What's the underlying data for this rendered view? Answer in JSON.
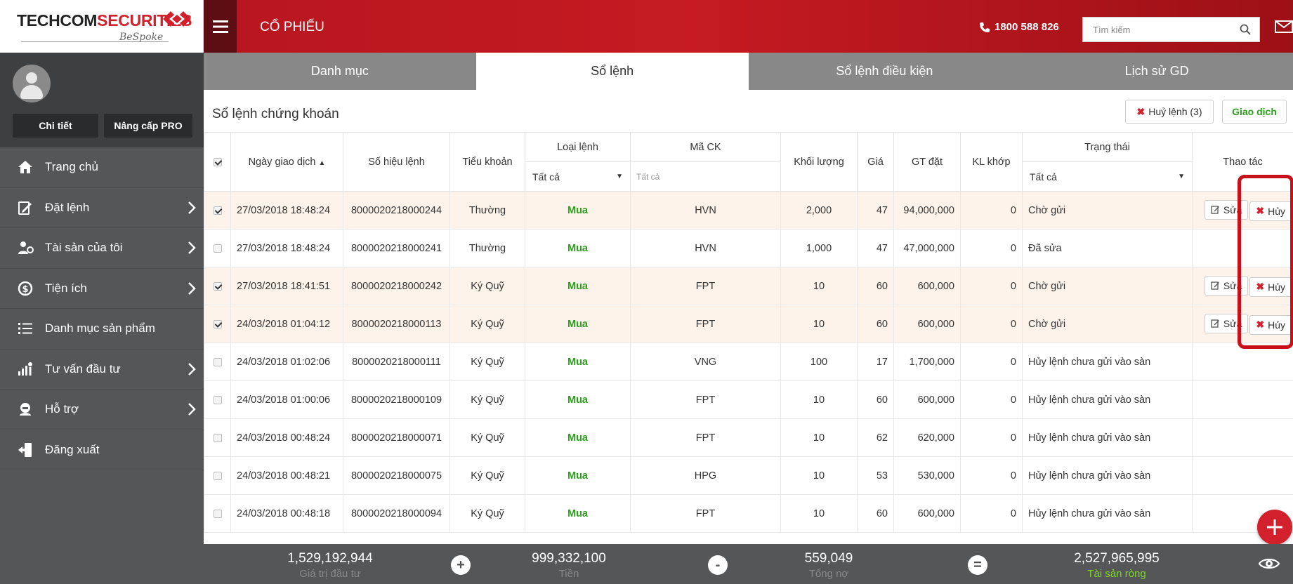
{
  "brand": {
    "name_black": "TECHCOM",
    "name_red": "SECURITIES",
    "sub": "BeSpoke"
  },
  "user": {
    "detail_label": "Chi tiết",
    "upgrade_label": "Nâng cấp PRO"
  },
  "menu": [
    {
      "label": "Trang chủ",
      "icon": "home-icon",
      "chevron": false
    },
    {
      "label": "Đặt lệnh",
      "icon": "order-icon",
      "chevron": true
    },
    {
      "label": "Tài sản của tôi",
      "icon": "assets-icon",
      "chevron": true
    },
    {
      "label": "Tiện ích",
      "icon": "utilities-icon",
      "chevron": true
    },
    {
      "label": "Danh mục sản phẩm",
      "icon": "list-icon",
      "chevron": false
    },
    {
      "label": "Tư vấn đầu tư",
      "icon": "advisory-icon",
      "chevron": true
    },
    {
      "label": "Hỗ trợ",
      "icon": "support-icon",
      "chevron": true
    },
    {
      "label": "Đăng xuất",
      "icon": "logout-icon",
      "chevron": false
    }
  ],
  "topbar": {
    "title": "CỔ PHIẾU",
    "phone": "1800 588 826",
    "search_placeholder": "Tìm kiếm"
  },
  "tabs": [
    {
      "label": "Danh mục",
      "active": false
    },
    {
      "label": "Sổ lệnh",
      "active": true
    },
    {
      "label": "Sổ lệnh điều kiện",
      "active": false
    },
    {
      "label": "Lịch sử GD",
      "active": false
    }
  ],
  "panel": {
    "title": "Sổ lệnh chứng khoán",
    "cancel_all_label": "Huỷ lệnh (3)",
    "trade_label": "Giao dịch"
  },
  "table": {
    "headers": {
      "date": "Ngày giao dịch",
      "order_no": "Số hiệu lệnh",
      "sub_account": "Tiểu khoản",
      "order_type": "Loại lệnh",
      "symbol": "Mã CK",
      "volume": "Khối lượng",
      "price": "Giá",
      "value": "GT đặt",
      "matched": "KL khớp",
      "status": "Trạng thái",
      "actions": "Thao tác"
    },
    "filters": {
      "order_type": "Tất cả",
      "symbol_placeholder": "Tất cả",
      "status": "Tất cả"
    },
    "edit_label": "Sửa",
    "cancel_label": "Hủy",
    "rows": [
      {
        "checked": true,
        "highlight": true,
        "date": "27/03/2018 18:48:24",
        "order_no": "8000020218000244",
        "sub_account": "Thường",
        "side": "Mua",
        "symbol": "HVN",
        "volume": "2,000",
        "price": "47",
        "value": "94,000,000",
        "matched": "0",
        "status": "Chờ gửi",
        "actions": true
      },
      {
        "checked": false,
        "highlight": false,
        "date": "27/03/2018 18:48:24",
        "order_no": "8000020218000241",
        "sub_account": "Thường",
        "side": "Mua",
        "symbol": "HVN",
        "volume": "1,000",
        "price": "47",
        "value": "47,000,000",
        "matched": "0",
        "status": "Đã sửa",
        "actions": false
      },
      {
        "checked": true,
        "highlight": true,
        "date": "27/03/2018 18:41:51",
        "order_no": "8000020218000242",
        "sub_account": "Ký Quỹ",
        "side": "Mua",
        "symbol": "FPT",
        "volume": "10",
        "price": "60",
        "value": "600,000",
        "matched": "0",
        "status": "Chờ gửi",
        "actions": true
      },
      {
        "checked": true,
        "highlight": true,
        "date": "24/03/2018 01:04:12",
        "order_no": "8000020218000113",
        "sub_account": "Ký Quỹ",
        "side": "Mua",
        "symbol": "FPT",
        "volume": "10",
        "price": "60",
        "value": "600,000",
        "matched": "0",
        "status": "Chờ gửi",
        "actions": true
      },
      {
        "checked": false,
        "highlight": false,
        "date": "24/03/2018 01:02:06",
        "order_no": "8000020218000111",
        "sub_account": "Ký Quỹ",
        "side": "Mua",
        "symbol": "VNG",
        "volume": "100",
        "price": "17",
        "value": "1,700,000",
        "matched": "0",
        "status": "Hủy lệnh chưa gửi vào sàn",
        "actions": false
      },
      {
        "checked": false,
        "highlight": false,
        "date": "24/03/2018 01:00:06",
        "order_no": "8000020218000109",
        "sub_account": "Ký Quỹ",
        "side": "Mua",
        "symbol": "FPT",
        "volume": "10",
        "price": "60",
        "value": "600,000",
        "matched": "0",
        "status": "Hủy lệnh chưa gửi vào sàn",
        "actions": false
      },
      {
        "checked": false,
        "highlight": false,
        "date": "24/03/2018 00:48:24",
        "order_no": "8000020218000071",
        "sub_account": "Ký Quỹ",
        "side": "Mua",
        "symbol": "FPT",
        "volume": "10",
        "price": "62",
        "value": "620,000",
        "matched": "0",
        "status": "Hủy lệnh chưa gửi vào sàn",
        "actions": false
      },
      {
        "checked": false,
        "highlight": false,
        "date": "24/03/2018 00:48:21",
        "order_no": "8000020218000075",
        "sub_account": "Ký Quỹ",
        "side": "Mua",
        "symbol": "HPG",
        "volume": "10",
        "price": "53",
        "value": "530,000",
        "matched": "0",
        "status": "Hủy lệnh chưa gửi vào sàn",
        "actions": false
      },
      {
        "checked": false,
        "highlight": false,
        "date": "24/03/2018 00:48:18",
        "order_no": "8000020218000094",
        "sub_account": "Ký Quỹ",
        "side": "Mua",
        "symbol": "FPT",
        "volume": "10",
        "price": "60",
        "value": "600,000",
        "matched": "0",
        "status": "Hủy lệnh chưa gửi vào sàn",
        "actions": false
      }
    ]
  },
  "footer": {
    "investment_value": "1,529,192,944",
    "investment_label": "Giá trị đầu tư",
    "cash_value": "999,332,100",
    "cash_label": "Tiền",
    "debt_value": "559,049",
    "debt_label": "Tổng nợ",
    "net_assets_value": "2,527,965,995",
    "net_assets_label": "Tài sản ròng",
    "op_plus": "+",
    "op_minus": "-",
    "op_equals": "="
  },
  "colors": {
    "brand_red": "#c51a22",
    "buy_green": "#2ca01c",
    "sidebar": "#555658",
    "highlight_row": "#fdf3ea",
    "net_assets_green": "#7dd624"
  }
}
